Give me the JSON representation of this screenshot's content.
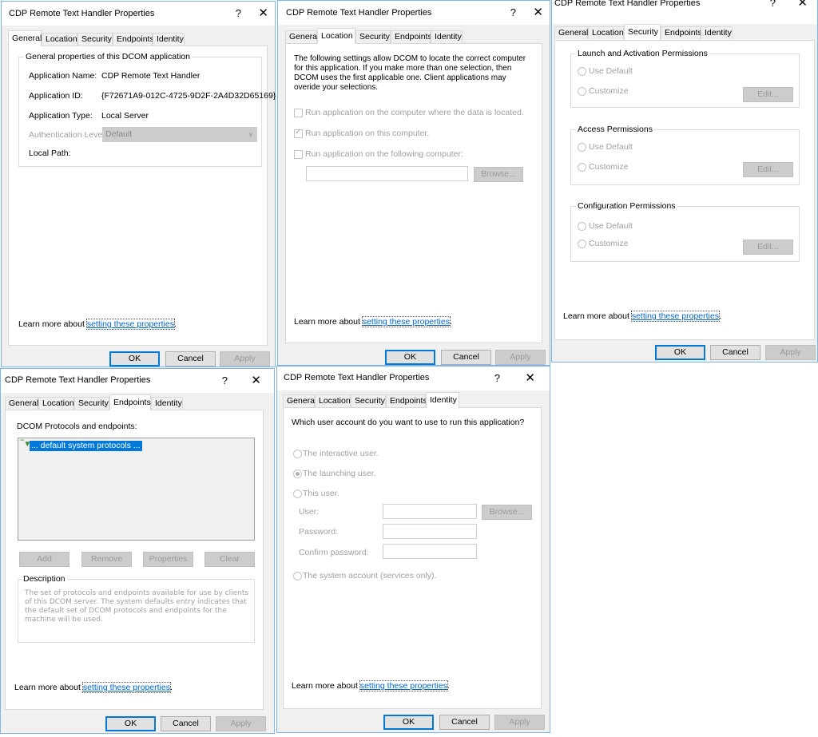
{
  "common": {
    "title": "CDP Remote Text Handler Properties",
    "help_glyph": "?",
    "close_glyph": "✕",
    "tabs": [
      "General",
      "Location",
      "Security",
      "Endpoints",
      "Identity"
    ],
    "learn_more_prefix": "Learn more about ",
    "learn_more_link": "setting these properties",
    "learn_more_suffix": ".",
    "ok": "OK",
    "cancel": "Cancel",
    "apply": "Apply"
  },
  "general": {
    "group_label": "General properties of this DCOM application",
    "rows": [
      {
        "label": "Application Name:",
        "value": "CDP Remote Text Handler"
      },
      {
        "label": "Application ID:",
        "value": "{F72671A9-012C-4725-9D2F-2A4D32D65169}"
      },
      {
        "label": "Application Type:",
        "value": "Local Server"
      }
    ],
    "auth_label": "Authentication Level:",
    "auth_value": "Default",
    "local_path_label": "Local Path:"
  },
  "location": {
    "intro": "The following settings allow DCOM to locate the correct computer for this application. If you make more than one selection, then DCOM uses the first applicable one. Client applications may overide your selections.",
    "options": [
      {
        "label": "Run application on the computer where the data is located.",
        "checked": false
      },
      {
        "label": "Run application on this computer.",
        "checked": true
      },
      {
        "label": "Run application on the following computer:",
        "checked": false
      }
    ],
    "computer_value": "",
    "browse": "Browse..."
  },
  "security": {
    "groups": [
      {
        "label": "Launch and Activation Permissions",
        "use_default": "Use Default",
        "customize": "Customize",
        "edit": "Edit..."
      },
      {
        "label": "Access Permissions",
        "use_default": "Use Default",
        "customize": "Customize",
        "edit": "Edit..."
      },
      {
        "label": "Configuration Permissions",
        "use_default": "Use Default",
        "customize": "Customize",
        "edit": "Edit..."
      }
    ]
  },
  "endpoints": {
    "list_label": "DCOM Protocols and endpoints:",
    "items": [
      "... default system protocols ..."
    ],
    "buttons": [
      "Add",
      "Remove",
      "Properties",
      "Clear"
    ],
    "description_label": "Description",
    "description": "The set of protocols and endpoints available for use by clients of this DCOM server. The system defaults entry indicates that the default set of DCOM protocols and endpoints for the machine will be used."
  },
  "identity": {
    "question": "Which user account do you want to use to run this application?",
    "options": [
      {
        "label": "The interactive user.",
        "checked": false
      },
      {
        "label": "The launching user.",
        "checked": true
      },
      {
        "label": "This user.",
        "checked": false
      },
      {
        "label": "The system account (services only).",
        "checked": false
      }
    ],
    "user_label": "User:",
    "password_label": "Password:",
    "confirm_label": "Confirm password:",
    "user_value": "",
    "password_value": "",
    "confirm_value": "",
    "browse": "Browse..."
  }
}
